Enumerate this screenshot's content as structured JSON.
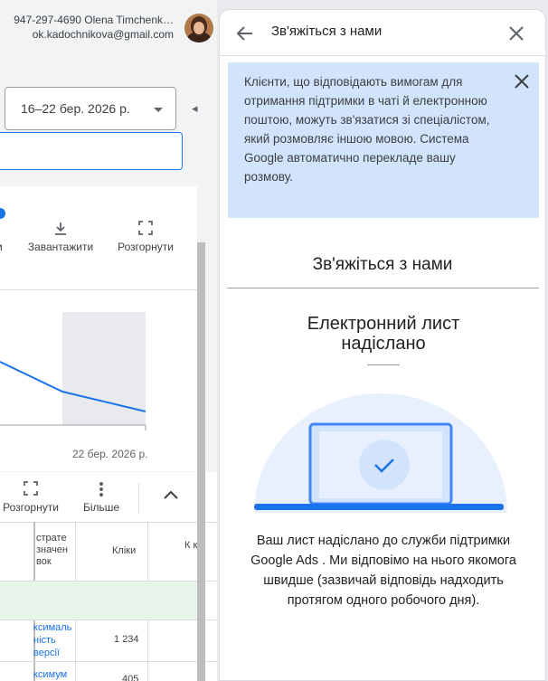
{
  "account": {
    "line1": "947-297-4690 Olena Timchenk…",
    "line2": "ok.kadochnikova@gmail.com"
  },
  "date_range": {
    "value": "16–22 бер. 2026 р."
  },
  "toolbar1": {
    "partial_label": "и",
    "download_label": "Завантажити",
    "expand_label": "Розгорнути"
  },
  "chart": {
    "x_end_label": "22 бер. 2026 р."
  },
  "toolbar2": {
    "expand_label": "Розгорнути",
    "more_label": "Більше"
  },
  "table": {
    "header_col1": "страте\nзначен\nвок",
    "header_clicks": "Кліки",
    "header_col3": "К к",
    "row1_link": "ксималь\nність\nверсії",
    "row1_clicks": "1 234",
    "row2_link": "ксимум",
    "row2_clicks": "405"
  },
  "panel": {
    "title": "Зв'яжіться з нами",
    "banner_text": "Клієнти, що відповідають вимогам для отримання підтримки в чаті й електронною поштою, можуть зв'язатися зі спеціалістом, який розмовляє іншою мовою. Система Google автоматично перекладе вашу розмову.",
    "section_title": "Зв'яжіться з нами",
    "confirm_title": "Електронний лист надіслано",
    "confirm_body": "Ваш лист надіслано до служби підтримки Google Ads . Ми відповімо на нього якомога швидше (зазвичай відповідь надходить протягом одного робочого дня)."
  },
  "colors": {
    "accent": "#1a73e8",
    "banner_bg": "#d2e3fc",
    "illustration_bg": "#e8f0fe"
  }
}
